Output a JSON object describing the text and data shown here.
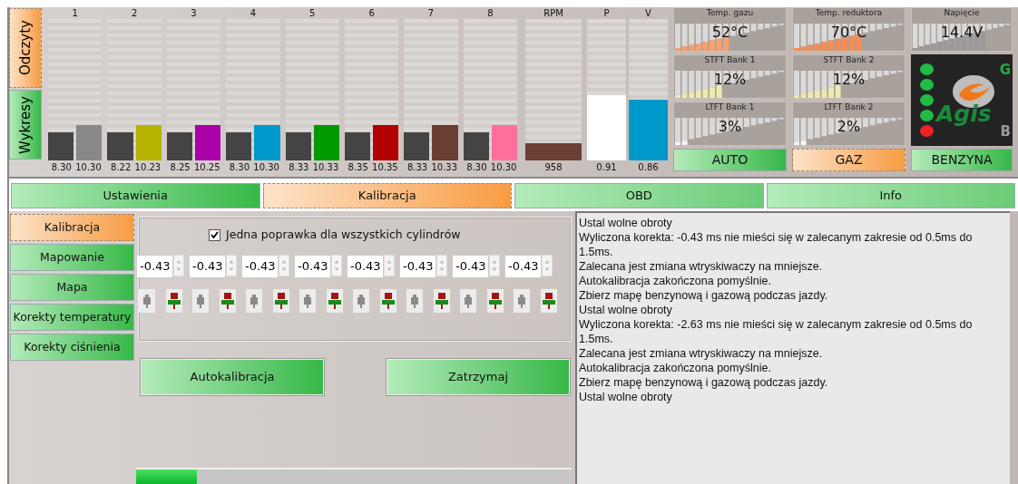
{
  "side_tabs": [
    {
      "label": "Odczyty",
      "selected": true
    },
    {
      "label": "Wykresy",
      "selected": false
    }
  ],
  "cylinders": [
    {
      "label": "1",
      "color": "#888888",
      "base": {
        "level": 0.2,
        "reading": "8.30"
      },
      "current": {
        "level": 0.25,
        "reading": "10.30"
      }
    },
    {
      "label": "2",
      "color": "#b3b300",
      "base": {
        "level": 0.2,
        "reading": "8.22"
      },
      "current": {
        "level": 0.25,
        "reading": "10.23"
      }
    },
    {
      "label": "3",
      "color": "#aa00aa",
      "base": {
        "level": 0.2,
        "reading": "8.25"
      },
      "current": {
        "level": 0.25,
        "reading": "10.25"
      }
    },
    {
      "label": "4",
      "color": "#0099cc",
      "base": {
        "level": 0.2,
        "reading": "8.30"
      },
      "current": {
        "level": 0.25,
        "reading": "10.30"
      }
    },
    {
      "label": "5",
      "color": "#009900",
      "base": {
        "level": 0.2,
        "reading": "8.33"
      },
      "current": {
        "level": 0.25,
        "reading": "10.33"
      }
    },
    {
      "label": "6",
      "color": "#b30000",
      "base": {
        "level": 0.2,
        "reading": "8.35"
      },
      "current": {
        "level": 0.25,
        "reading": "10.35"
      }
    },
    {
      "label": "7",
      "color": "#693e33",
      "base": {
        "level": 0.2,
        "reading": "8.33"
      },
      "current": {
        "level": 0.25,
        "reading": "10.33"
      }
    },
    {
      "label": "8",
      "color": "#ff6f9c",
      "base": {
        "level": 0.2,
        "reading": "8.30"
      },
      "current": {
        "level": 0.25,
        "reading": "10.30"
      }
    }
  ],
  "rpm": {
    "label": "RPM",
    "level": 0.12,
    "reading": "958"
  },
  "pv": [
    {
      "label": "P",
      "level": 0.46,
      "reading": "0.91",
      "color": "#ffffff"
    },
    {
      "label": "V",
      "level": 0.43,
      "reading": "0.86",
      "color": "#0099cc"
    }
  ],
  "gauges": [
    {
      "title": "Temp. gazu",
      "reading": "52°C",
      "level": 0.5,
      "color": "#f9a070"
    },
    {
      "title": "Temp. reduktora",
      "reading": "70°C",
      "level": 0.63,
      "color": "#f58d55"
    },
    {
      "title": "Napięcie",
      "reading": "14.4V",
      "level": 0.72,
      "color": "#999999"
    },
    {
      "title": "STFT Bank 1",
      "reading": "12%",
      "level": 0.44,
      "color": "#efeab0"
    },
    {
      "title": "STFT Bank 2",
      "reading": "12%",
      "level": 0.44,
      "color": "#efeab0"
    },
    {
      "title": "LTFT Bank 1",
      "reading": "3%",
      "level": 0.12,
      "color": "#f6f6f6"
    },
    {
      "title": "LTFT Bank 2",
      "reading": "2%",
      "level": 0.12,
      "color": "#f6f6f6"
    }
  ],
  "logo_panel": {
    "leds": [
      {
        "color": "#22bb44"
      },
      {
        "color": "#22bb44"
      },
      {
        "color": "#22bb44"
      },
      {
        "color": "#22bb44"
      },
      {
        "color": "#ee2222"
      }
    ],
    "brand": "Agis",
    "letter_top": "G",
    "letter_bottom": "B"
  },
  "modes": [
    {
      "label": "AUTO",
      "selected": false
    },
    {
      "label": "GAZ",
      "selected": true
    },
    {
      "label": "BENZYNA",
      "selected": false
    }
  ],
  "main_tabs": [
    {
      "label": "Ustawienia",
      "selected": false
    },
    {
      "label": "Kalibracja",
      "selected": true
    },
    {
      "label": "OBD",
      "selected": false
    },
    {
      "label": "Info",
      "selected": false
    }
  ],
  "sub_tabs": [
    {
      "label": "Kalibracja",
      "selected": true
    },
    {
      "label": "Mapowanie",
      "selected": false
    },
    {
      "label": "Mapa",
      "selected": false
    },
    {
      "label": "Korekty temperatury",
      "selected": false
    },
    {
      "label": "Korekty ciśnienia",
      "selected": false
    }
  ],
  "single_correction": {
    "label": "Jedna poprawka dla wszystkich cylindrów",
    "checked": true
  },
  "corrections": [
    {
      "value": "-0.43"
    },
    {
      "value": "-0.43"
    },
    {
      "value": "-0.43"
    },
    {
      "value": "-0.43"
    },
    {
      "value": "-0.43"
    },
    {
      "value": "-0.43"
    },
    {
      "value": "-0.43"
    },
    {
      "value": "-0.43"
    }
  ],
  "buttons": [
    "Autokalibracja",
    "Zatrzymaj"
  ],
  "progress": {
    "level": 0.14
  },
  "log": [
    "Ustal wolne obroty",
    "Wyliczona korekta: -0.43 ms nie mieści się w zalecanym zakresie od 0.5ms do 1.5ms.",
    "Zalecana jest zmiana wtryskiwaczy na mniejsze.",
    "Autokalibracja zakończona pomyślnie.",
    "Zbierz mapę benzynową i gazową podczas jazdy.",
    "Ustal wolne obroty",
    "Wyliczona korekta: -2.63 ms nie mieści się w zalecanym zakresie od 0.5ms do 1.5ms.",
    "Zalecana jest zmiana wtryskiwaczy na mniejsze.",
    "Autokalibracja zakończona pomyślnie.",
    "Zbierz mapę benzynową i gazową podczas jazdy.",
    "Ustal wolne obroty"
  ]
}
